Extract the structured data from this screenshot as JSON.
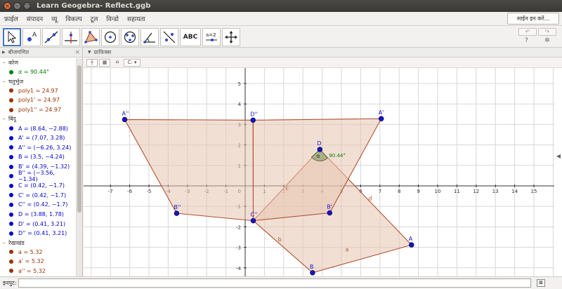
{
  "window": {
    "title": "Learn Geogebra- Reflect.ggb"
  },
  "menu": {
    "items": [
      "फ़ाईल",
      "संपादन",
      "व्यू",
      "विकल्प",
      "टूल",
      "विन्डो",
      "सहायता"
    ],
    "signin_label": "साईन इन करें..."
  },
  "toolbar": {
    "tools": [
      {
        "name": "move-tool",
        "icon": "cursor-arrow-icon",
        "selected": true
      },
      {
        "name": "point-tool",
        "icon": "point-a-icon"
      },
      {
        "name": "line-tool",
        "icon": "line-through-points-icon"
      },
      {
        "name": "perpendicular-tool",
        "icon": "perpendicular-line-icon"
      },
      {
        "name": "polygon-tool",
        "icon": "polygon-icon"
      },
      {
        "name": "circle-tool",
        "icon": "circle-center-point-icon"
      },
      {
        "name": "ellipse-tool",
        "icon": "ellipse-icon"
      },
      {
        "name": "angle-tool",
        "icon": "angle-icon"
      },
      {
        "name": "reflect-tool",
        "icon": "reflect-about-line-icon"
      },
      {
        "name": "text-tool",
        "icon": "text-abc-icon",
        "label": "ABC"
      },
      {
        "name": "slider-tool",
        "icon": "slider-icon",
        "label": "a=2"
      },
      {
        "name": "move-graphics-tool",
        "icon": "move-graphics-icon"
      }
    ],
    "undo_icon": "undo-icon",
    "redo_icon": "redo-icon",
    "help_label": "?",
    "settings_icon": "gear-icon"
  },
  "algebra": {
    "header": "बीजगणित",
    "categories": [
      {
        "label": "कोण",
        "items": [
          {
            "text": "α = 90.44°",
            "color": "#007f00"
          }
        ]
      },
      {
        "label": "चतुर्भुज",
        "items": [
          {
            "text": "poly1 = 24.97",
            "color": "#993300"
          },
          {
            "text": "poly1' = 24.97",
            "color": "#993300"
          },
          {
            "text": "poly1'' = 24.97",
            "color": "#993300"
          }
        ]
      },
      {
        "label": "बिंदु",
        "items": [
          {
            "text": "A = (8.64, −2.88)",
            "color": "#0000cc"
          },
          {
            "text": "A' = (7.07, 3.28)",
            "color": "#0000cc"
          },
          {
            "text": "A'' = (−6.26, 3.24)",
            "color": "#0000cc"
          },
          {
            "text": "B = (3.5, −4.24)",
            "color": "#0000cc"
          },
          {
            "text": "B' = (4.39, −1.32)",
            "color": "#0000cc"
          },
          {
            "text": "B'' = (−3.56, −1.34)",
            "color": "#0000cc"
          },
          {
            "text": "C = (0.42, −1.7)",
            "color": "#0000cc"
          },
          {
            "text": "C' = (0.42, −1.7)",
            "color": "#0000cc"
          },
          {
            "text": "C'' = (0.42, −1.7)",
            "color": "#0000cc"
          },
          {
            "text": "D = (3.88, 1.78)",
            "color": "#0000cc"
          },
          {
            "text": "D' = (0.41, 3.21)",
            "color": "#0000cc"
          },
          {
            "text": "D'' = (0.41, 3.21)",
            "color": "#0000cc"
          }
        ]
      },
      {
        "label": "रेखाखंड",
        "items": [
          {
            "text": "a = 5.32",
            "color": "#993300"
          },
          {
            "text": "a' = 5.32",
            "color": "#993300"
          },
          {
            "text": "a'' = 5.32",
            "color": "#993300"
          }
        ]
      }
    ]
  },
  "graphics": {
    "header": "ग्राफिक्स",
    "axis_menu_label": "C:",
    "x_ticks": [
      -7,
      -6,
      -5,
      -4,
      -3,
      -2,
      -1,
      0,
      1,
      2,
      3,
      4,
      5,
      6,
      7,
      8,
      9,
      10,
      11,
      12,
      13,
      14,
      15
    ],
    "y_ticks": [
      -4,
      -3,
      -2,
      -1,
      0,
      1,
      2,
      3,
      4,
      5
    ],
    "points": [
      {
        "label": "A",
        "x": 8.64,
        "y": -2.88
      },
      {
        "label": "A'",
        "x": 7.07,
        "y": 3.28
      },
      {
        "label": "A''",
        "x": -6.26,
        "y": 3.24
      },
      {
        "label": "B",
        "x": 3.5,
        "y": -4.24
      },
      {
        "label": "B'",
        "x": 4.39,
        "y": -1.32
      },
      {
        "label": "B''",
        "x": -3.56,
        "y": -1.34
      },
      {
        "label": "C''",
        "x": 0.42,
        "y": -1.7
      },
      {
        "label": "D",
        "x": 3.88,
        "y": 1.78
      },
      {
        "label": "D''",
        "x": 0.41,
        "y": 3.21
      }
    ],
    "polygons": [
      {
        "name": "poly1",
        "vertices": [
          [
            0.42,
            -1.7
          ],
          [
            3.5,
            -4.24
          ],
          [
            8.64,
            -2.88
          ],
          [
            3.88,
            1.78
          ]
        ]
      },
      {
        "name": "poly1'",
        "vertices": [
          [
            0.42,
            -1.7
          ],
          [
            4.39,
            -1.32
          ],
          [
            7.07,
            3.28
          ],
          [
            0.41,
            3.21
          ]
        ]
      },
      {
        "name": "poly1''",
        "vertices": [
          [
            0.42,
            -1.7
          ],
          [
            -3.56,
            -1.34
          ],
          [
            -6.26,
            3.24
          ],
          [
            0.41,
            3.21
          ]
        ]
      }
    ],
    "segment_labels": [
      {
        "text": "a",
        "x": 5.2,
        "y": -3.2
      },
      {
        "text": "b",
        "x": 1.7,
        "y": -2.7
      },
      {
        "text": "c",
        "x": 2.1,
        "y": -0.2
      },
      {
        "text": "d",
        "x": 6.4,
        "y": -0.7
      }
    ],
    "angle": {
      "label": "α",
      "value_text": "90.44°",
      "vertex": [
        3.88,
        1.78
      ]
    },
    "colors": {
      "poly_fill": "#e8c4b0",
      "poly_edge": "#b05030",
      "point": "#1515cc",
      "angle_fill": "#9aa77a",
      "grid": "#d7d7d7"
    }
  },
  "inputbar": {
    "label": "इनपुट:",
    "help_label": "⊠"
  }
}
